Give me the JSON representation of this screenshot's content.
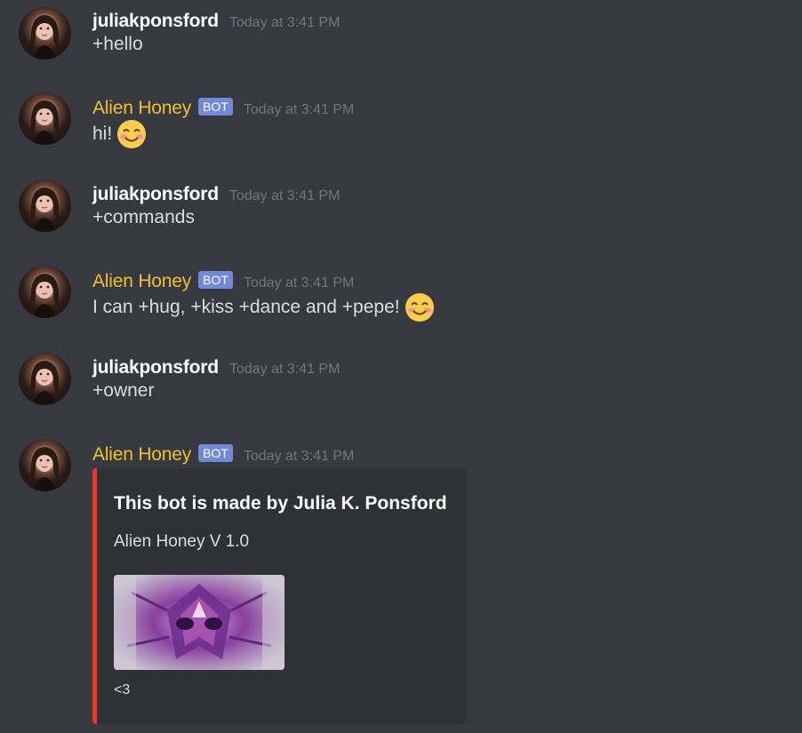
{
  "messages": [
    {
      "author": "juliakponsford",
      "is_bot": false,
      "timestamp": "Today at 3:41 PM",
      "text": "+hello",
      "emoji": null
    },
    {
      "author": "Alien Honey",
      "is_bot": true,
      "badge": "BOT",
      "timestamp": "Today at 3:41 PM",
      "text": "hi!",
      "emoji": "smiling-face-with-smiling-eyes"
    },
    {
      "author": "juliakponsford",
      "is_bot": false,
      "timestamp": "Today at 3:41 PM",
      "text": "+commands",
      "emoji": null
    },
    {
      "author": "Alien Honey",
      "is_bot": true,
      "badge": "BOT",
      "timestamp": "Today at 3:41 PM",
      "text": "I can +hug, +kiss +dance and +pepe!",
      "emoji": "smiling-face-with-smiling-eyes"
    },
    {
      "author": "juliakponsford",
      "is_bot": false,
      "timestamp": "Today at 3:41 PM",
      "text": "+owner",
      "emoji": null
    },
    {
      "author": "Alien Honey",
      "is_bot": true,
      "badge": "BOT",
      "timestamp": "Today at 3:41 PM",
      "text": "",
      "emoji": null
    }
  ],
  "embed": {
    "title": "This bot is made by Julia K. Ponsford",
    "description": "Alien Honey V 1.0",
    "image": "alien-honey-image",
    "footer": "<3",
    "accent_color": "#e53935"
  },
  "colors": {
    "background": "#36393f",
    "bot_name": "#f0c02a",
    "bot_badge": "#7289da",
    "timestamp": "#72767d",
    "embed_background": "#2f3136"
  }
}
